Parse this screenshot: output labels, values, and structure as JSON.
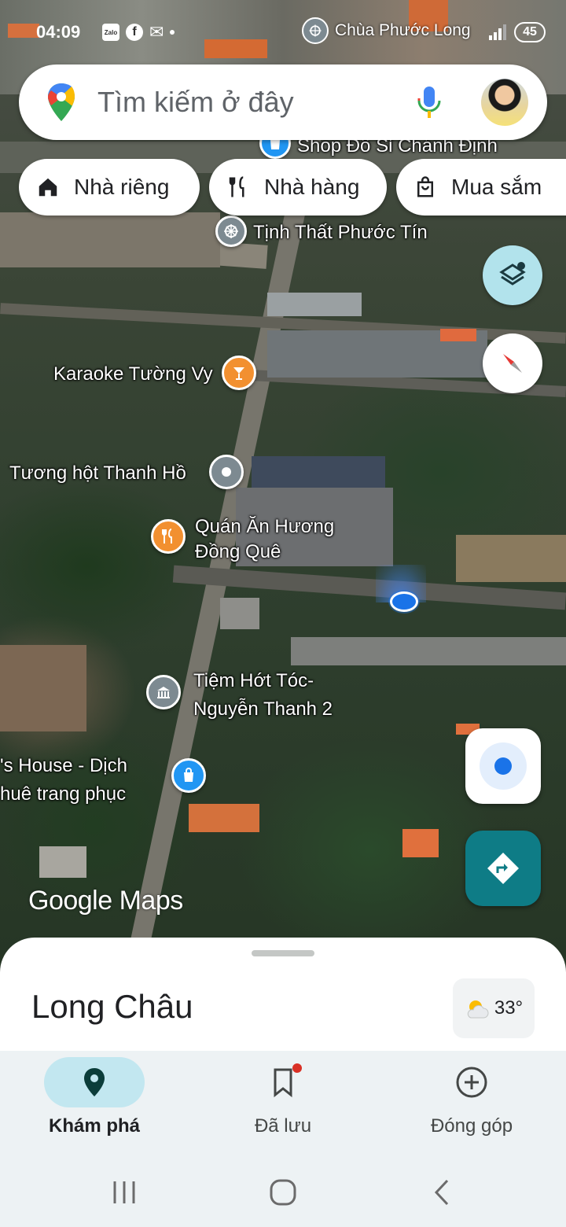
{
  "status_bar": {
    "time": "04:09",
    "app_icons": [
      "Zalo",
      "facebook-icon",
      "mail-icon"
    ],
    "notification_place": "Chùa Phước Long",
    "battery": "45"
  },
  "search": {
    "placeholder": "Tìm kiếm ở đây"
  },
  "chips": [
    {
      "label": "Nhà riêng",
      "icon": "home-icon"
    },
    {
      "label": "Nhà hàng",
      "icon": "restaurant-icon"
    },
    {
      "label": "Mua sắm",
      "icon": "shopping-bag-icon"
    }
  ],
  "map": {
    "labels": {
      "shop_do_si": "Shop Đồ Sỉ Chánh Định",
      "tinh_that": "Tịnh Thất Phước Tín",
      "karaoke": "Karaoke Tường Vy",
      "tuong_hot": "Tương hột Thanh Hồ",
      "quan_an_1": "Quán Ăn Hương",
      "quan_an_2": "Đồng Quê",
      "tiem_hot_toc_1": "Tiệm Hớt Tóc-",
      "tiem_hot_toc_2": "Nguyễn Thanh 2",
      "house_1": "'s House - Dịch",
      "house_2": "huê trang phục"
    },
    "watermark": "Google Maps",
    "colors": {
      "karaoke": "#f29030",
      "restaurant": "#f29030",
      "generic_poi": "#7d8a91",
      "shopping": "#2196f3",
      "user_location": "#1a73e8",
      "directions_button": "#0e7c86",
      "layers_button": "#b2e3ec"
    }
  },
  "sheet": {
    "place_name": "Long Châu",
    "weather_temp": "33°"
  },
  "bottom_nav": [
    {
      "label": "Khám phá",
      "icon": "explore-pin-icon",
      "active": true
    },
    {
      "label": "Đã lưu",
      "icon": "bookmark-icon",
      "active": false,
      "badge": true
    },
    {
      "label": "Đóng góp",
      "icon": "add-circle-icon",
      "active": false
    }
  ]
}
